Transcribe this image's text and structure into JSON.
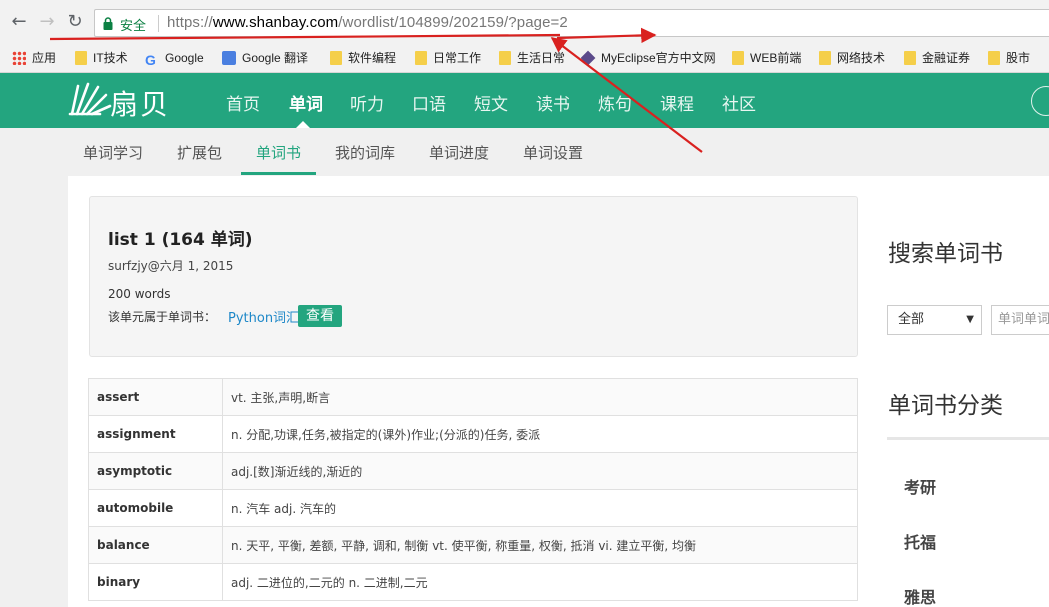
{
  "browser": {
    "back_icon": "←",
    "forward_icon": "→",
    "reload_icon": "↻",
    "secure_label": "安全",
    "url_scheme": "https://",
    "url_host": "www.shanbay.com",
    "url_path": "/wordlist/104899/202159/?page=2"
  },
  "bookmarks": [
    {
      "label": "应用",
      "icon": "apps-icon"
    },
    {
      "label": "IT技术",
      "icon": "folder-icon"
    },
    {
      "label": "Google",
      "icon": "google-icon"
    },
    {
      "label": "Google 翻译",
      "icon": "translate-icon"
    },
    {
      "label": "软件编程",
      "icon": "folder-icon"
    },
    {
      "label": "日常工作",
      "icon": "folder-icon"
    },
    {
      "label": "生活日常",
      "icon": "folder-icon"
    },
    {
      "label": "MyEclipse官方中文网",
      "icon": "myeclipse-icon"
    },
    {
      "label": "WEB前端",
      "icon": "folder-icon"
    },
    {
      "label": "网络技术",
      "icon": "folder-icon"
    },
    {
      "label": "金融证券",
      "icon": "folder-icon"
    },
    {
      "label": "股市",
      "icon": "folder-icon"
    }
  ],
  "site": {
    "logo_text": "扇贝",
    "brand_color": "#23a57f",
    "nav": [
      "首页",
      "单词",
      "听力",
      "口语",
      "短文",
      "读书",
      "炼句",
      "课程",
      "社区"
    ],
    "nav_active": "单词",
    "sub_nav": [
      "单词学习",
      "扩展包",
      "单词书",
      "我的词库",
      "单词进度",
      "单词设置"
    ],
    "sub_nav_active": "单词书"
  },
  "list": {
    "title": "list 1 (164 单词)",
    "author_date": "surfzjy@六月 1, 2015",
    "word_count": "200 words",
    "belongs_label": "该单元属于单词书：",
    "book_link": "Python词汇",
    "view_button": "查看"
  },
  "words": [
    {
      "word": "assert",
      "definition": "vt. 主张,声明,断言"
    },
    {
      "word": "assignment",
      "definition": "n. 分配,功课,任务,被指定的(课外)作业;(分派的)任务, 委派"
    },
    {
      "word": "asymptotic",
      "definition": "adj.[数]渐近线的,渐近的"
    },
    {
      "word": "automobile",
      "definition": "n. 汽车 adj. 汽车的"
    },
    {
      "word": "balance",
      "definition": "n. 天平, 平衡, 差额, 平静, 调和, 制衡 vt. 使平衡, 称重量, 权衡, 抵消 vi. 建立平衡, 均衡"
    },
    {
      "word": "binary",
      "definition": "adj. 二进位的,二元的 n. 二进制,二元"
    }
  ],
  "sidebar": {
    "search_title": "搜索单词书",
    "filter_selected": "全部",
    "search_placeholder": "单词单词书",
    "category_title": "单词书分类",
    "categories": [
      "考研",
      "托福",
      "雅思"
    ]
  }
}
